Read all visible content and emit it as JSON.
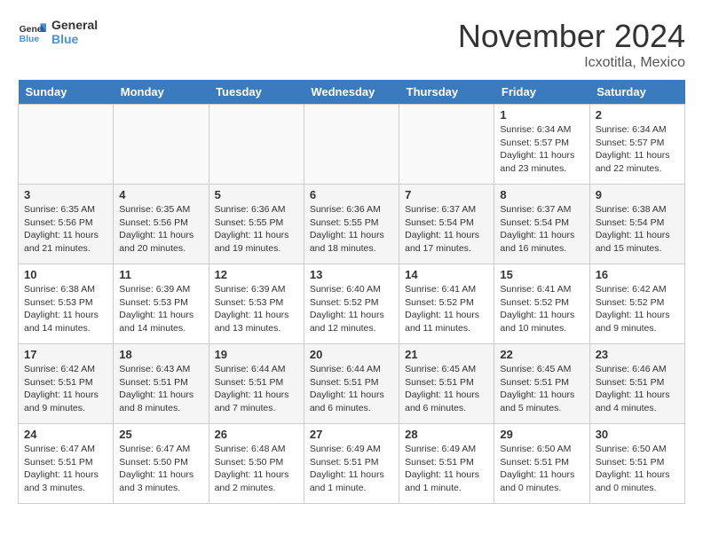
{
  "logo": {
    "line1": "General",
    "line2": "Blue"
  },
  "header": {
    "month": "November 2024",
    "location": "Icxotitla, Mexico"
  },
  "days_of_week": [
    "Sunday",
    "Monday",
    "Tuesday",
    "Wednesday",
    "Thursday",
    "Friday",
    "Saturday"
  ],
  "weeks": [
    [
      {
        "day": "",
        "info": ""
      },
      {
        "day": "",
        "info": ""
      },
      {
        "day": "",
        "info": ""
      },
      {
        "day": "",
        "info": ""
      },
      {
        "day": "",
        "info": ""
      },
      {
        "day": "1",
        "info": "Sunrise: 6:34 AM\nSunset: 5:57 PM\nDaylight: 11 hours and 23 minutes."
      },
      {
        "day": "2",
        "info": "Sunrise: 6:34 AM\nSunset: 5:57 PM\nDaylight: 11 hours and 22 minutes."
      }
    ],
    [
      {
        "day": "3",
        "info": "Sunrise: 6:35 AM\nSunset: 5:56 PM\nDaylight: 11 hours and 21 minutes."
      },
      {
        "day": "4",
        "info": "Sunrise: 6:35 AM\nSunset: 5:56 PM\nDaylight: 11 hours and 20 minutes."
      },
      {
        "day": "5",
        "info": "Sunrise: 6:36 AM\nSunset: 5:55 PM\nDaylight: 11 hours and 19 minutes."
      },
      {
        "day": "6",
        "info": "Sunrise: 6:36 AM\nSunset: 5:55 PM\nDaylight: 11 hours and 18 minutes."
      },
      {
        "day": "7",
        "info": "Sunrise: 6:37 AM\nSunset: 5:54 PM\nDaylight: 11 hours and 17 minutes."
      },
      {
        "day": "8",
        "info": "Sunrise: 6:37 AM\nSunset: 5:54 PM\nDaylight: 11 hours and 16 minutes."
      },
      {
        "day": "9",
        "info": "Sunrise: 6:38 AM\nSunset: 5:54 PM\nDaylight: 11 hours and 15 minutes."
      }
    ],
    [
      {
        "day": "10",
        "info": "Sunrise: 6:38 AM\nSunset: 5:53 PM\nDaylight: 11 hours and 14 minutes."
      },
      {
        "day": "11",
        "info": "Sunrise: 6:39 AM\nSunset: 5:53 PM\nDaylight: 11 hours and 14 minutes."
      },
      {
        "day": "12",
        "info": "Sunrise: 6:39 AM\nSunset: 5:53 PM\nDaylight: 11 hours and 13 minutes."
      },
      {
        "day": "13",
        "info": "Sunrise: 6:40 AM\nSunset: 5:52 PM\nDaylight: 11 hours and 12 minutes."
      },
      {
        "day": "14",
        "info": "Sunrise: 6:41 AM\nSunset: 5:52 PM\nDaylight: 11 hours and 11 minutes."
      },
      {
        "day": "15",
        "info": "Sunrise: 6:41 AM\nSunset: 5:52 PM\nDaylight: 11 hours and 10 minutes."
      },
      {
        "day": "16",
        "info": "Sunrise: 6:42 AM\nSunset: 5:52 PM\nDaylight: 11 hours and 9 minutes."
      }
    ],
    [
      {
        "day": "17",
        "info": "Sunrise: 6:42 AM\nSunset: 5:51 PM\nDaylight: 11 hours and 9 minutes."
      },
      {
        "day": "18",
        "info": "Sunrise: 6:43 AM\nSunset: 5:51 PM\nDaylight: 11 hours and 8 minutes."
      },
      {
        "day": "19",
        "info": "Sunrise: 6:44 AM\nSunset: 5:51 PM\nDaylight: 11 hours and 7 minutes."
      },
      {
        "day": "20",
        "info": "Sunrise: 6:44 AM\nSunset: 5:51 PM\nDaylight: 11 hours and 6 minutes."
      },
      {
        "day": "21",
        "info": "Sunrise: 6:45 AM\nSunset: 5:51 PM\nDaylight: 11 hours and 6 minutes."
      },
      {
        "day": "22",
        "info": "Sunrise: 6:45 AM\nSunset: 5:51 PM\nDaylight: 11 hours and 5 minutes."
      },
      {
        "day": "23",
        "info": "Sunrise: 6:46 AM\nSunset: 5:51 PM\nDaylight: 11 hours and 4 minutes."
      }
    ],
    [
      {
        "day": "24",
        "info": "Sunrise: 6:47 AM\nSunset: 5:51 PM\nDaylight: 11 hours and 3 minutes."
      },
      {
        "day": "25",
        "info": "Sunrise: 6:47 AM\nSunset: 5:50 PM\nDaylight: 11 hours and 3 minutes."
      },
      {
        "day": "26",
        "info": "Sunrise: 6:48 AM\nSunset: 5:50 PM\nDaylight: 11 hours and 2 minutes."
      },
      {
        "day": "27",
        "info": "Sunrise: 6:49 AM\nSunset: 5:51 PM\nDaylight: 11 hours and 1 minute."
      },
      {
        "day": "28",
        "info": "Sunrise: 6:49 AM\nSunset: 5:51 PM\nDaylight: 11 hours and 1 minute."
      },
      {
        "day": "29",
        "info": "Sunrise: 6:50 AM\nSunset: 5:51 PM\nDaylight: 11 hours and 0 minutes."
      },
      {
        "day": "30",
        "info": "Sunrise: 6:50 AM\nSunset: 5:51 PM\nDaylight: 11 hours and 0 minutes."
      }
    ]
  ]
}
